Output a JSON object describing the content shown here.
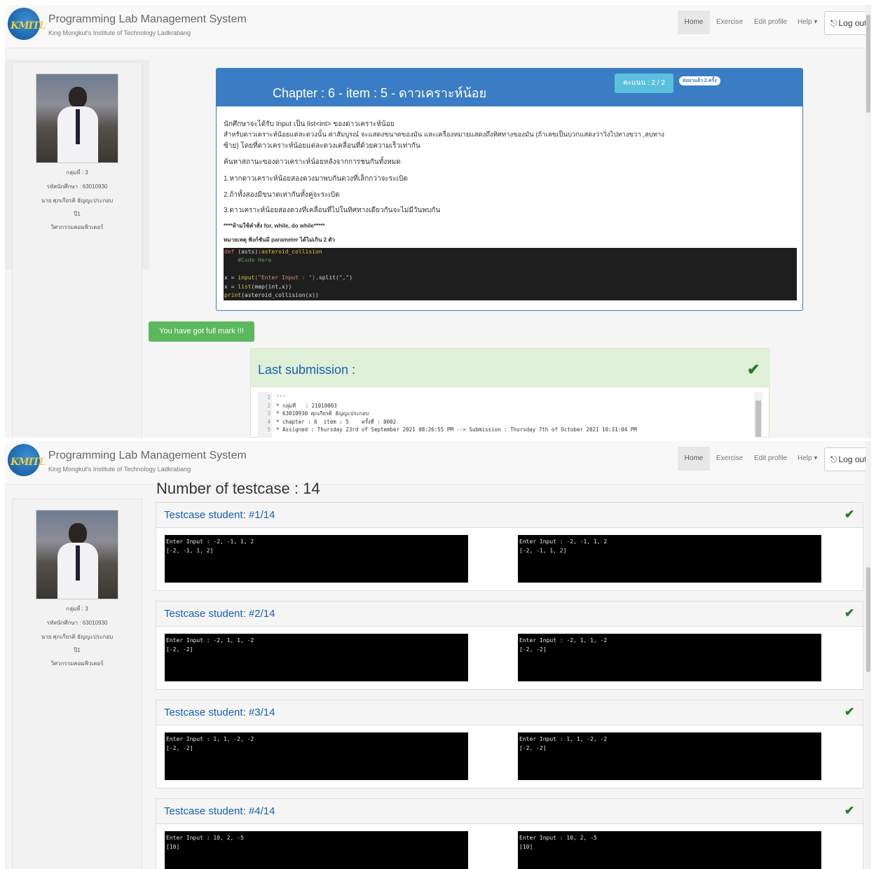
{
  "brand": {
    "title": "Programming Lab Management System",
    "subtitle": "King Mongkut's Institute of Technology Ladkrabang",
    "logo_text": "KMITL"
  },
  "nav": {
    "home": "Home",
    "exercise": "Exercise",
    "edit_profile": "Edit profile",
    "help": "Help ▾",
    "logout": "Log out"
  },
  "student": {
    "group": "กลุ่มที่ : 3",
    "id": "รหัสนักศึกษา : 63010930",
    "name": "นาย ศุภเกียรติ ธัญญะประกอบ",
    "year": "ปี1",
    "major": "วิศวกรรมคอมพิวเตอร์"
  },
  "problem": {
    "title": "Chapter : 6 - item : 5 - ดาวเคราะห์น้อย",
    "score": "คะแนน : 2 / 2",
    "sent": "ส่งมาแล้ว 2 ครั้ง",
    "lines": [
      "นักศึกษาจะได้รับ Input เป็น list<int> ของดาวเคราะห์น้อย",
      "สำหรับดาวเคราะห์น้อยแต่ละดวงนั้น ค่าสัมบูรณ์ จะแสดงขนาดของมัน และเครื่องหมายแสดงถึงทิศทางของมัน (ถ้าเลขเป็นบวกแสดงว่าวิ่งไปทางขวา ,ลบทาง",
      "ซ้าย) โดยที่ดาวเคราะห์น้อยแต่ละดวงเคลื่อนที่ด้วยความเร็วเท่ากัน",
      "ค้นหาสถานะของดาวเคราะห์น้อยหลังจากการชนกันทั้งหมด",
      "1.หากดาวเคราะห์น้อยสองดวงมาพบกันดวงที่เล็กกว่าจะระเบิด",
      "2.ถ้าทั้งสองมีขนาดเท่ากันทั้งคู่จะระเบิด",
      "3.ดาวเคราะห์น้อยสองดวงที่เคลื่อนที่ไปในทิศทางเดียวกันจะไม่มีวันพบกัน",
      "****ห้ามใช้คำสั่ง for, while, do while*****",
      "หมายเหตุ ฟังก์ชันมี parameter ได้ไม่เกิน 2 ตัว"
    ],
    "code": [
      {
        "k": "def ",
        "f": "asteroid_collision",
        "t": "(asts):"
      },
      {
        "c": "    #Code Here"
      },
      {
        "t": ""
      },
      {
        "t": "x = ",
        "f": "input",
        "s": "(\"Enter Input : \")",
        "t2": ".split(\",\")"
      },
      {
        "t": "x = ",
        "f": "list",
        "t2": "(map(int,x))"
      },
      {
        "f": "print",
        "t2": "(asteroid_collision(x))"
      }
    ]
  },
  "full_mark": "You have got full mark !!!",
  "last_submission": {
    "title": "Last submission :",
    "lines": [
      "'''",
      "* กลุ่มที่   : 21010003",
      "* 63010930 ศุภเกียรติ ธัญญะประกอบ",
      "* chapter : 6  item : 5    ครั้งที่ : 0002",
      "* Assigned : Thursday 23rd of September 2021 08:26:55 PM --> Submission : Thursday 7th of October 2021 10:31:04 PM"
    ]
  },
  "testcases": {
    "heading": "Number of testcase : 14",
    "items": [
      {
        "title": "Testcase student: #1/14",
        "input": "Enter Input : -2, -1, 1, 2",
        "output": "[-2, -1, 1, 2]"
      },
      {
        "title": "Testcase student: #2/14",
        "input": "Enter Input : -2, 1, 1, -2",
        "output": "[-2, -2]"
      },
      {
        "title": "Testcase student: #3/14",
        "input": "Enter Input : 1, 1, -2, -2",
        "output": "[-2, -2]"
      },
      {
        "title": "Testcase student: #4/14",
        "input": "Enter Input : 10, 2, -5",
        "output": "[10]"
      }
    ]
  },
  "colors": {
    "panel": "#3b7dc4",
    "success": "#5cb85c",
    "link": "#1a5fb4",
    "check": "#2a7a2a"
  },
  "icons": {
    "check": "check-icon",
    "logout": "sign-out-icon"
  }
}
